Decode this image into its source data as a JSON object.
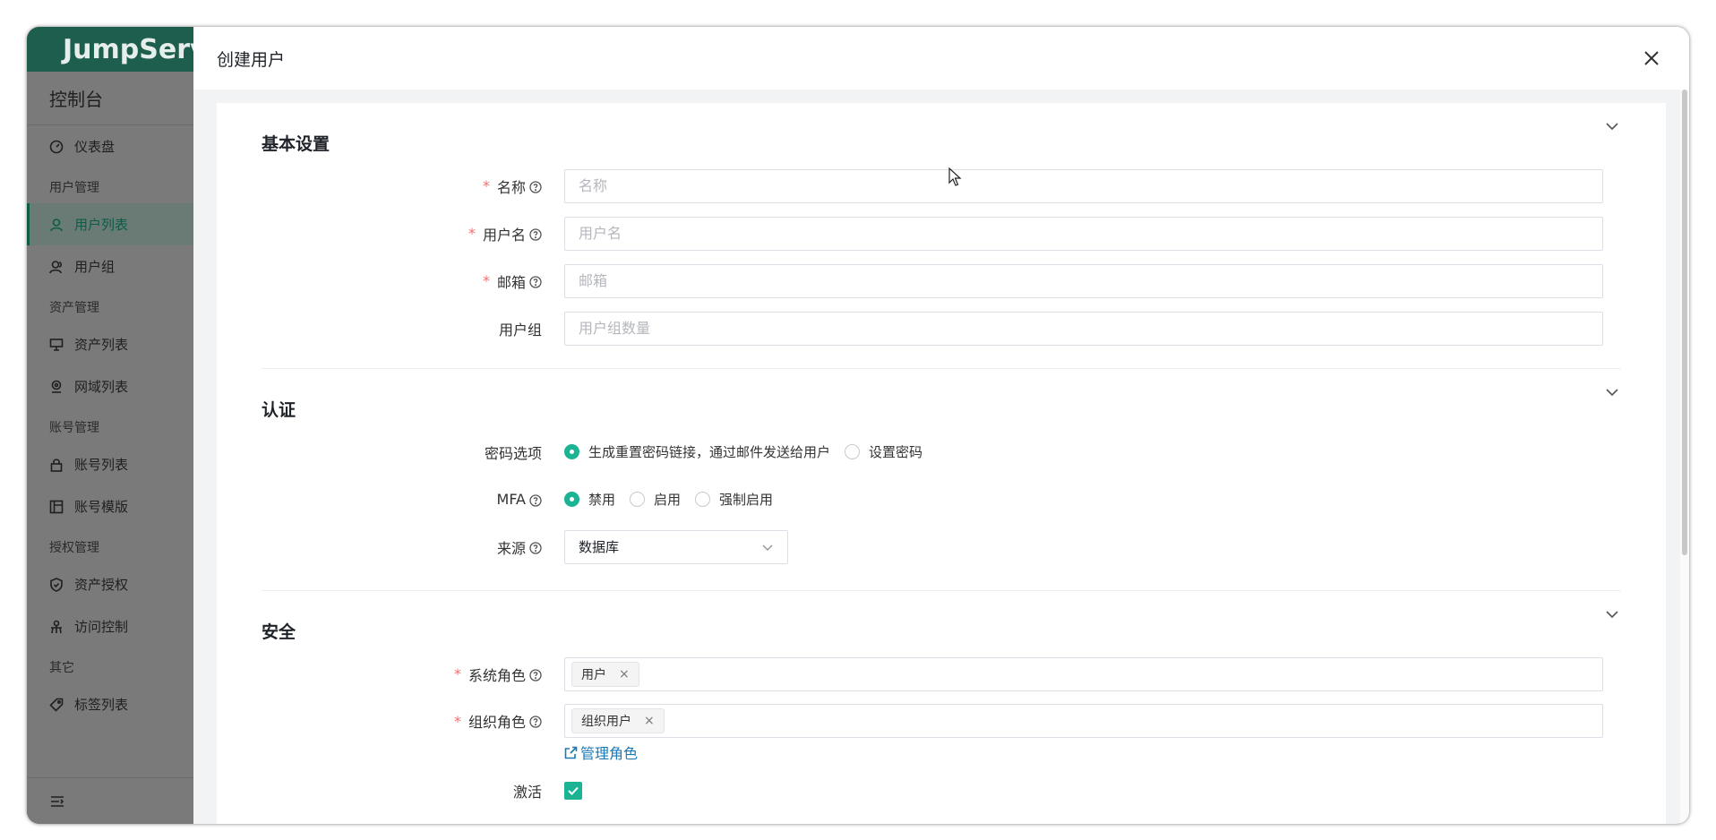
{
  "sidebar": {
    "brand": "JumpServer",
    "console_title": "控制台",
    "items": [
      {
        "type": "item",
        "label": "仪表盘",
        "icon": "dashboard-icon"
      },
      {
        "type": "group",
        "label": "用户管理"
      },
      {
        "type": "item",
        "label": "用户列表",
        "icon": "user-icon",
        "active": true
      },
      {
        "type": "item",
        "label": "用户组",
        "icon": "user-group-icon"
      },
      {
        "type": "group",
        "label": "资产管理"
      },
      {
        "type": "item",
        "label": "资产列表",
        "icon": "monitor-icon"
      },
      {
        "type": "item",
        "label": "网域列表",
        "icon": "location-icon"
      },
      {
        "type": "group",
        "label": "账号管理"
      },
      {
        "type": "item",
        "label": "账号列表",
        "icon": "lock-icon"
      },
      {
        "type": "item",
        "label": "账号模版",
        "icon": "template-icon"
      },
      {
        "type": "group",
        "label": "授权管理"
      },
      {
        "type": "item",
        "label": "资产授权",
        "icon": "shield-icon"
      },
      {
        "type": "item",
        "label": "访问控制",
        "icon": "access-control-icon"
      },
      {
        "type": "group",
        "label": "其它"
      },
      {
        "type": "item",
        "label": "标签列表",
        "icon": "tag-icon"
      }
    ],
    "footer_icon": "collapse-menu-icon"
  },
  "drawer": {
    "title": "创建用户",
    "close_icon": "close-icon"
  },
  "sections": {
    "basic": {
      "title": "基本设置",
      "name": {
        "label": "名称",
        "placeholder": "名称",
        "value": ""
      },
      "username": {
        "label": "用户名",
        "placeholder": "用户名",
        "value": ""
      },
      "email": {
        "label": "邮箱",
        "placeholder": "邮箱",
        "value": ""
      },
      "groups": {
        "label": "用户组",
        "placeholder": "用户组数量"
      }
    },
    "auth": {
      "title": "认证",
      "password": {
        "label": "密码选项",
        "options": [
          "生成重置密码链接，通过邮件发送给用户",
          "设置密码"
        ],
        "selected": "生成重置密码链接，通过邮件发送给用户"
      },
      "mfa": {
        "label": "MFA",
        "options": [
          "禁用",
          "启用",
          "强制启用"
        ],
        "selected": "禁用"
      },
      "source": {
        "label": "来源",
        "value": "数据库"
      }
    },
    "security": {
      "title": "安全",
      "system_role": {
        "label": "系统角色",
        "tags": [
          "用户"
        ]
      },
      "org_role": {
        "label": "组织角色",
        "tags": [
          "组织用户"
        ]
      },
      "manage_roles_link": "管理角色",
      "active": {
        "label": "激活",
        "checked": true
      }
    }
  },
  "colors": {
    "brand_dark": "#1e5e4e",
    "accent": "#1ab394",
    "required": "#f56c6c",
    "link": "#1a79b5"
  }
}
